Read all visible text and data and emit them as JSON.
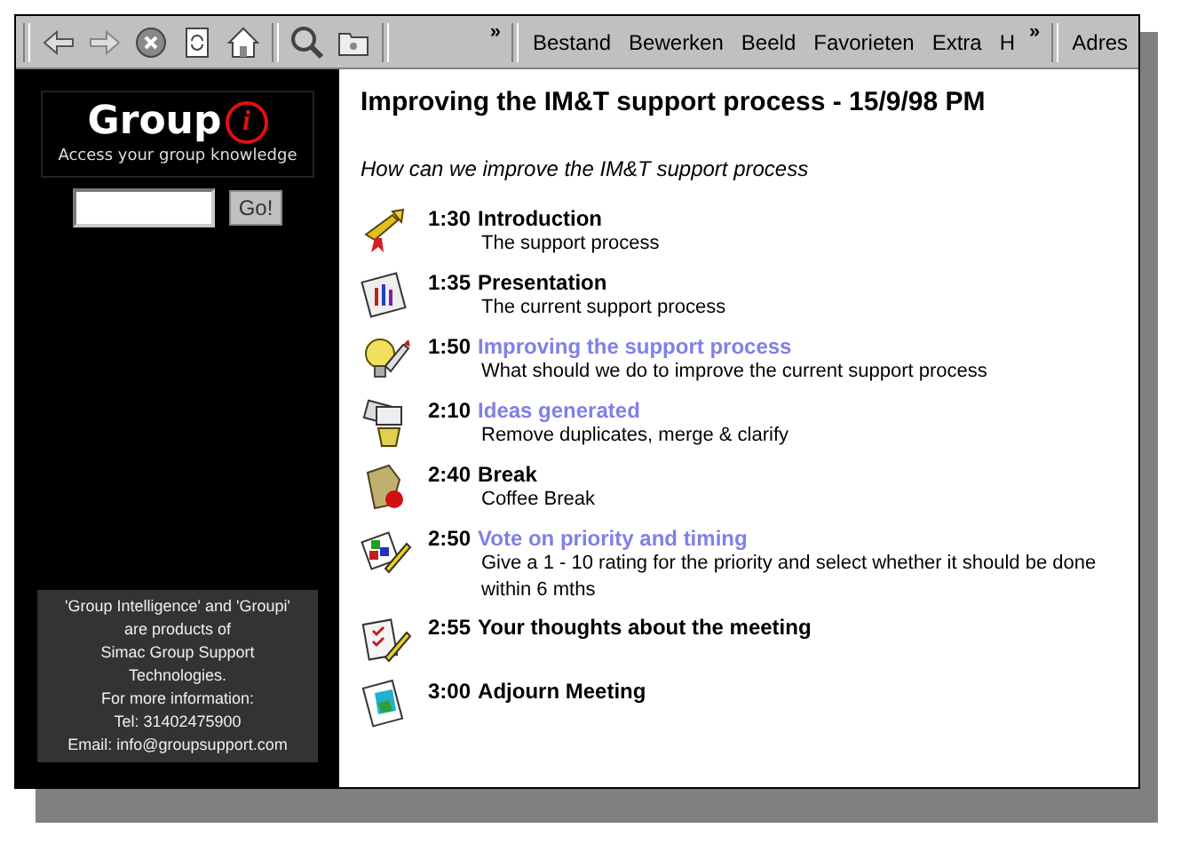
{
  "toolbar": {
    "chevrons": [
      "»",
      "»"
    ],
    "menus": [
      "Bestand",
      "Bewerken",
      "Beeld",
      "Favorieten",
      "Extra",
      "H"
    ],
    "address_label": "Adres"
  },
  "sidebar": {
    "logo": {
      "name": "Group",
      "mark": "i",
      "tagline": "Access your group knowledge"
    },
    "search": {
      "button": "Go!"
    },
    "info": [
      "'Group Intelligence' and 'Groupi'",
      "are products of",
      "Simac Group Support",
      "Technologies.",
      "For more information:",
      "Tel: 31402475900",
      "Email: info@groupsupport.com"
    ]
  },
  "page": {
    "title": "Improving the IM&T support process - 15/9/98 PM",
    "subtitle": "How can we improve the IM&T support process",
    "agenda": [
      {
        "time": "1:30",
        "title": "Introduction",
        "kind": "heading",
        "description": [
          "The support process"
        ]
      },
      {
        "time": "1:35",
        "title": "Presentation",
        "kind": "heading",
        "description": [
          "The current support process"
        ]
      },
      {
        "time": "1:50",
        "title": "Improving the support process",
        "kind": "link",
        "description": [
          "What should we do to improve the current support process"
        ]
      },
      {
        "time": "2:10",
        "title": "Ideas generated",
        "kind": "link",
        "description": [
          "Remove duplicates, merge & clarify"
        ]
      },
      {
        "time": "2:40",
        "title": "Break",
        "kind": "heading",
        "description": [
          "Coffee Break"
        ]
      },
      {
        "time": "2:50",
        "title": "Vote on priority and timing",
        "kind": "link",
        "description": [
          "Give a 1 - 10 rating for the priority and select whether it should be done",
          "within 6 mths"
        ]
      },
      {
        "time": "2:55",
        "title": "Your thoughts about the meeting",
        "kind": "heading"
      },
      {
        "time": "3:00",
        "title": "Adjourn Meeting",
        "kind": "heading"
      }
    ]
  }
}
